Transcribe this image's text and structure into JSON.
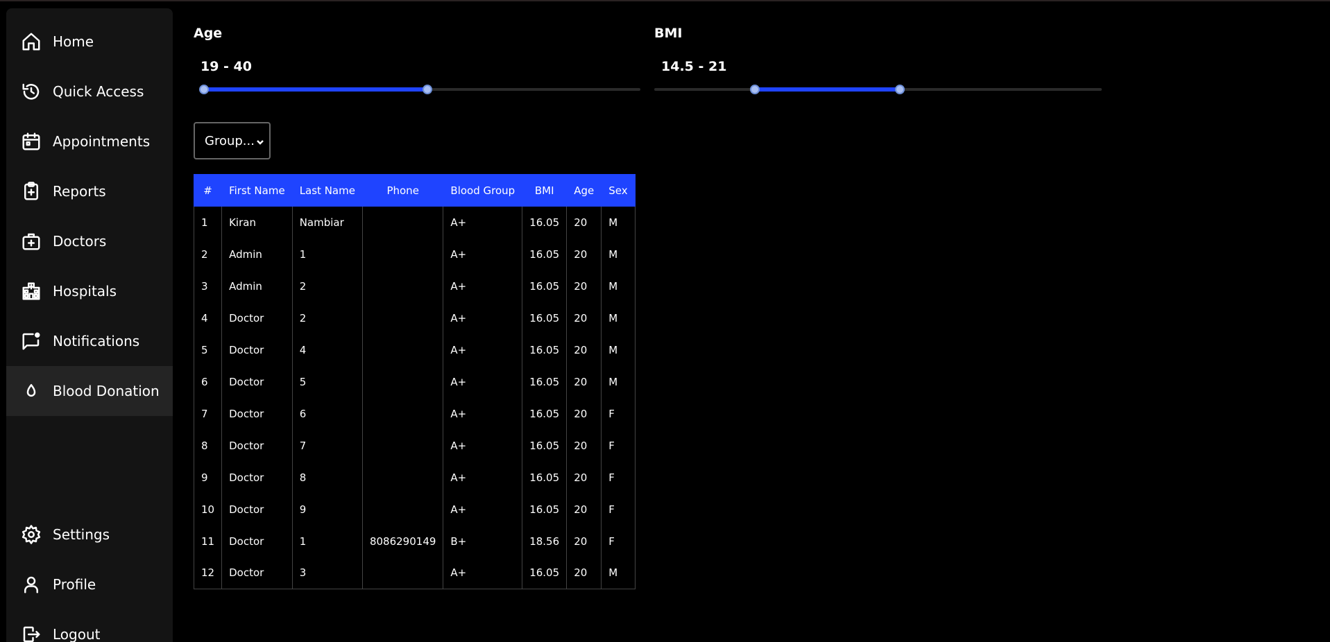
{
  "sidebar": {
    "items": [
      {
        "label": "Home",
        "icon": "home-icon"
      },
      {
        "label": "Quick Access",
        "icon": "history-icon"
      },
      {
        "label": "Appointments",
        "icon": "calendar-icon"
      },
      {
        "label": "Reports",
        "icon": "clipboard-plus-icon"
      },
      {
        "label": "Doctors",
        "icon": "medical-bag-icon"
      },
      {
        "label": "Hospitals",
        "icon": "hospital-icon"
      },
      {
        "label": "Notifications",
        "icon": "chat-notification-icon"
      },
      {
        "label": "Blood Donation",
        "icon": "droplet-icon",
        "active": true
      }
    ],
    "bottom_items": [
      {
        "label": "Settings",
        "icon": "gear-icon"
      },
      {
        "label": "Profile",
        "icon": "user-icon"
      },
      {
        "label": "Logout",
        "icon": "logout-icon"
      }
    ]
  },
  "filters": {
    "age": {
      "title": "Age",
      "value_text": "19 - 40",
      "min": 19,
      "max": 40
    },
    "bmi": {
      "title": "BMI",
      "value_text": "14.5 - 21",
      "min": 14.5,
      "max": 21
    }
  },
  "group_select": {
    "selected": "Group..."
  },
  "table": {
    "headers": [
      "#",
      "First Name",
      "Last Name",
      "Phone",
      "Blood Group",
      "BMI",
      "Age",
      "Sex"
    ],
    "rows": [
      [
        "1",
        "Kiran",
        "Nambiar",
        "",
        "A+",
        "16.05",
        "20",
        "M"
      ],
      [
        "2",
        "Admin",
        "1",
        "",
        "A+",
        "16.05",
        "20",
        "M"
      ],
      [
        "3",
        "Admin",
        "2",
        "",
        "A+",
        "16.05",
        "20",
        "M"
      ],
      [
        "4",
        "Doctor",
        "2",
        "",
        "A+",
        "16.05",
        "20",
        "M"
      ],
      [
        "5",
        "Doctor",
        "4",
        "",
        "A+",
        "16.05",
        "20",
        "M"
      ],
      [
        "6",
        "Doctor",
        "5",
        "",
        "A+",
        "16.05",
        "20",
        "M"
      ],
      [
        "7",
        "Doctor",
        "6",
        "",
        "A+",
        "16.05",
        "20",
        "F"
      ],
      [
        "8",
        "Doctor",
        "7",
        "",
        "A+",
        "16.05",
        "20",
        "F"
      ],
      [
        "9",
        "Doctor",
        "8",
        "",
        "A+",
        "16.05",
        "20",
        "F"
      ],
      [
        "10",
        "Doctor",
        "9",
        "",
        "A+",
        "16.05",
        "20",
        "F"
      ],
      [
        "11",
        "Doctor",
        "1",
        "8086290149",
        "B+",
        "18.56",
        "20",
        "F"
      ],
      [
        "12",
        "Doctor",
        "3",
        "",
        "A+",
        "16.05",
        "20",
        "M"
      ]
    ]
  },
  "colors": {
    "accent": "#1f44ff",
    "background": "#000000",
    "sidebar": "#141414"
  }
}
